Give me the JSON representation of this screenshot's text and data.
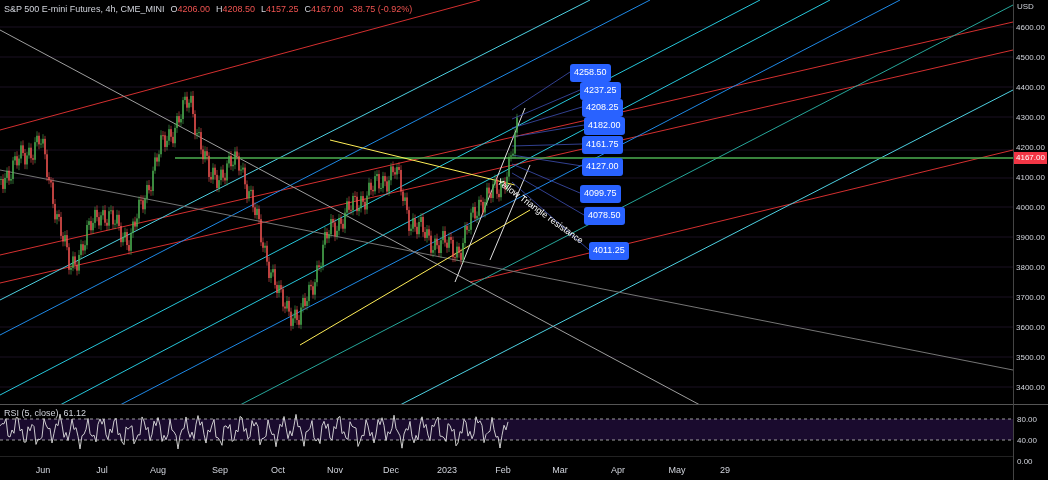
{
  "header": {
    "symbol": "S&P 500 E-mini Futures, 4h, CME_MINI",
    "ohlc": [
      {
        "label": "O",
        "value": "4206.00"
      },
      {
        "label": "H",
        "value": "4208.50"
      },
      {
        "label": "L",
        "value": "4157.25"
      },
      {
        "label": "C",
        "value": "4167.00"
      }
    ],
    "change": "-38.75 (-0.92%)"
  },
  "price_axis": {
    "currency": "USD",
    "ticks": [
      "4600.00",
      "4500.00",
      "4400.00",
      "4300.00",
      "4200.00",
      "4100.00",
      "4000.00",
      "3900.00",
      "3800.00",
      "3700.00",
      "3600.00",
      "3500.00",
      "3400.00"
    ],
    "last_price": "4167.00"
  },
  "price_labels": [
    "4258.50",
    "4237.25",
    "4208.25",
    "4182.00",
    "4161.75",
    "4127.00",
    "4099.75",
    "4078.50",
    "4011.25"
  ],
  "annotation": "Yellow Triangle resistance",
  "rsi": {
    "label": "RSI (5, close)",
    "value": "61.12",
    "ticks": [
      "80.00",
      "40.00",
      "0.00"
    ]
  },
  "time_axis": [
    "Jun",
    "Jul",
    "Aug",
    "Sep",
    "Oct",
    "Nov",
    "Dec",
    "2023",
    "Feb",
    "Mar",
    "Apr",
    "May",
    "29"
  ]
}
